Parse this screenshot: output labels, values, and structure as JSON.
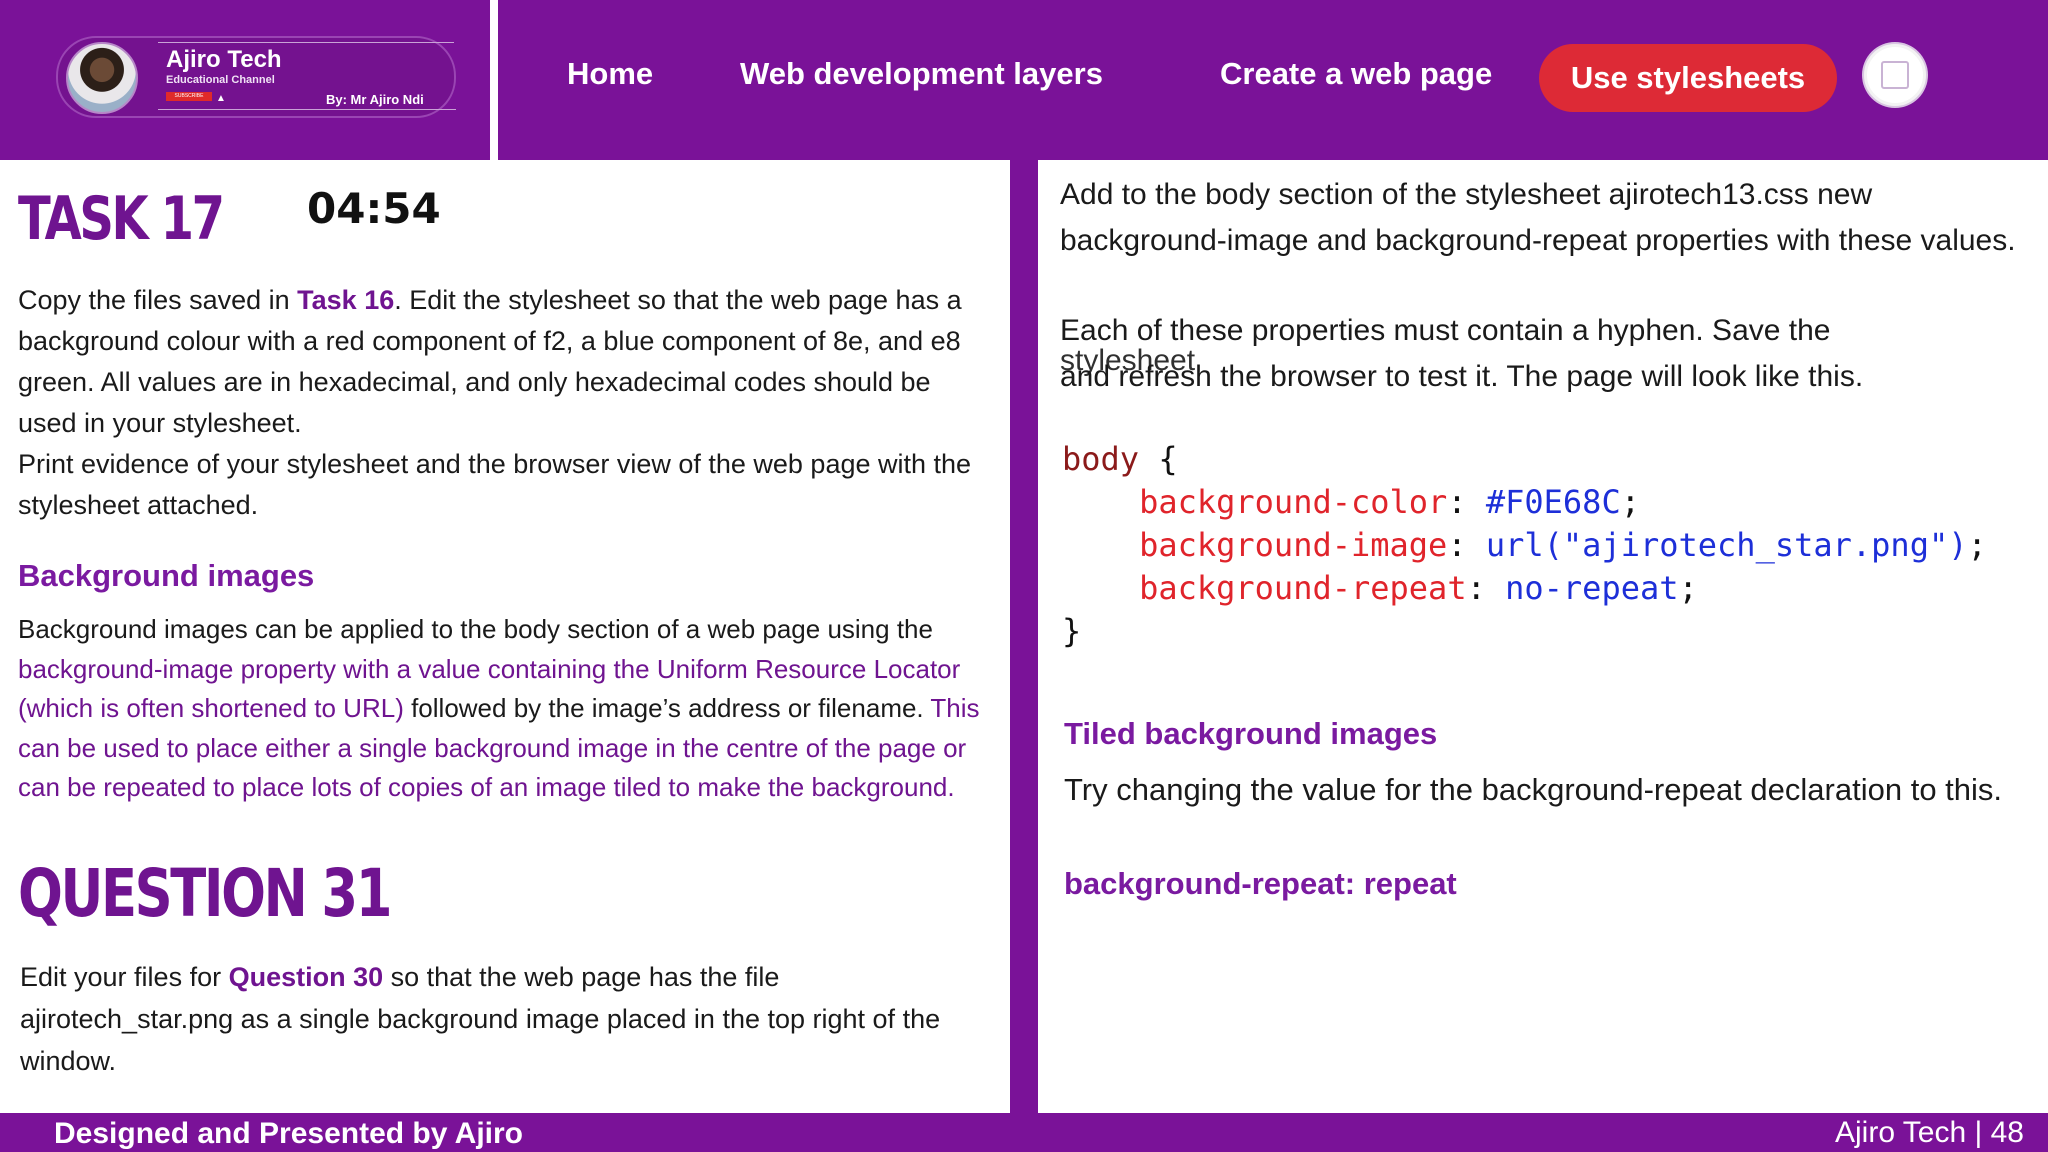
{
  "header": {
    "brand": "Ajiro Tech",
    "brand_sub": "Educational Channel",
    "subscribe": "SUBSCRIBE",
    "byline": "By: Mr Ajiro Ndi",
    "nav": [
      "Home",
      "Web development layers",
      "Create a web page",
      "Use stylesheets"
    ]
  },
  "left": {
    "task_title": "TASK 17",
    "timer": "04:54",
    "task_p1_a": "Copy the files saved in ",
    "task_p1_link": "Task 16",
    "task_p1_b": ". Edit the stylesheet so that the web page has a background colour with a red component of f2, a blue component of 8e, and e8 green. All values are in hexadecimal, and only hexadecimal codes should be used in your stylesheet.",
    "task_p2": "Print evidence of your stylesheet and the browser view of the web page with the stylesheet attached.",
    "bg_heading": "Background images",
    "bg_p_a": "Background images can be applied to the body section of a web page using the ",
    "bg_p_b": "background-image property with a value containing the Uniform Resource Locator (which is often shortened to URL)",
    "bg_p_c": " followed by the image’s address or filename. ",
    "bg_p_d": "This can be used to place either a single background image in the centre of the page or can be repeated to place lots of copies of an image tiled to make the background.",
    "q_title": "QUESTION 31",
    "q_a": "Edit your files for ",
    "q_link": "Question 30",
    "q_b": " so that the web page has the file ajirotech_star.png as a single background image placed in the top right of the window."
  },
  "right": {
    "p1": "Add to the body section of the stylesheet ajirotech13.css new background-image and background-repeat properties with these values.",
    "p2": "Each of these properties must contain a hyphen. Save the",
    "overlap_a": "stylesheet",
    "overlap_b": "and refresh the browser to test it. The page will look like this.",
    "code": {
      "selector": "body",
      "open": " {",
      "lines": [
        {
          "prop": "background-color",
          "val": "#F0E68C"
        },
        {
          "prop": "background-image",
          "val": "url(\"ajirotech_star.png\")"
        },
        {
          "prop": "background-repeat",
          "val": "no-repeat"
        }
      ],
      "close": "}"
    },
    "tiled_heading": "Tiled background images",
    "tiled_p": "Try changing the value for the  background-repeat declaration to this.",
    "tiled_code": "background-repeat: repeat"
  },
  "footer": {
    "left": "Designed and Presented by Ajiro",
    "right": "Ajiro Tech | 48"
  }
}
